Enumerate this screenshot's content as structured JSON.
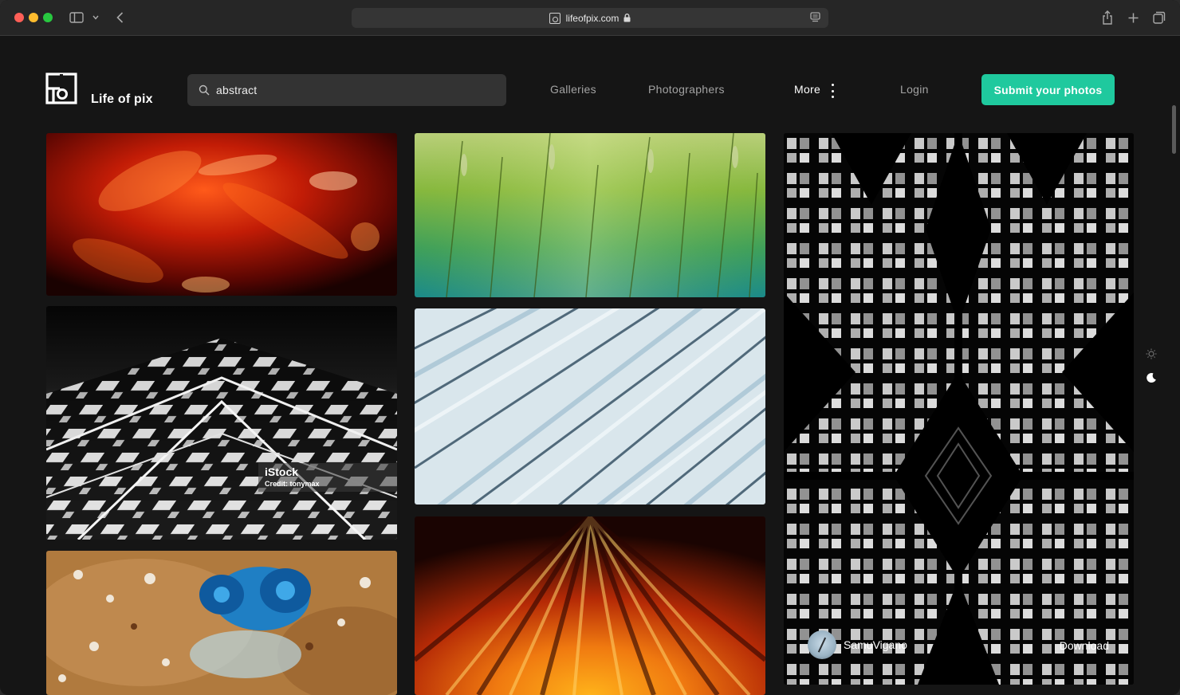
{
  "browser": {
    "url": "lifeofpix.com",
    "icons": [
      "sidebar-toggle-icon",
      "chevron-down-icon",
      "back-arrow-icon",
      "lock-icon",
      "reader-icon",
      "share-icon",
      "new-tab-icon",
      "tabs-overview-icon"
    ]
  },
  "site": {
    "logo_text": "Life of pix",
    "search": {
      "value": "abstract"
    },
    "nav": {
      "galleries": "Galleries",
      "photographers": "Photographers",
      "more": "More",
      "login": "Login"
    },
    "submit_label": "Submit your photos",
    "colors": {
      "accent": "#1fc99e",
      "background": "#151515",
      "search_bg": "#333333"
    }
  },
  "gallery": {
    "photos": [
      {
        "subject": "red abstract light bokeh"
      },
      {
        "subject": "black and white geometric architecture",
        "sponsor": "iStock",
        "credit": "Credit: tonymax"
      },
      {
        "subject": "orange and blue mineral texture"
      },
      {
        "subject": "green grass close-up"
      },
      {
        "subject": "glacier ice crevasses"
      },
      {
        "subject": "orange light streaks"
      },
      {
        "subject": "symmetrical building windows",
        "author": "SamuVigano",
        "download_label": "Download"
      }
    ]
  },
  "theme_toggle": {
    "icons": [
      "sun-icon",
      "moon-icon"
    ]
  }
}
